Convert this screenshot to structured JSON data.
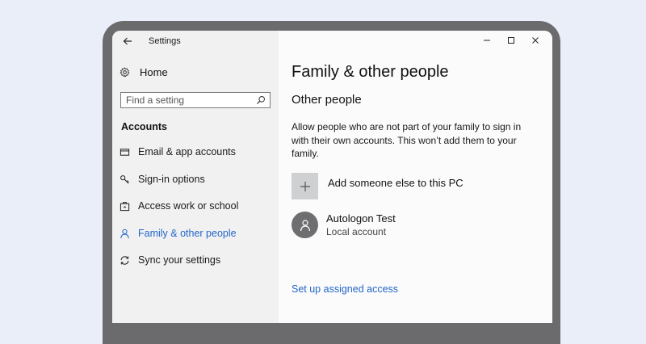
{
  "window": {
    "title": "Settings",
    "controls": [
      "minimize-icon",
      "maximize-icon",
      "close-icon"
    ]
  },
  "sidebar": {
    "home_label": "Home",
    "search_placeholder": "Find a setting",
    "section_label": "Accounts",
    "items": [
      {
        "label": "Email & app accounts",
        "icon": "card-icon",
        "active": false
      },
      {
        "label": "Sign-in options",
        "icon": "key-icon",
        "active": false
      },
      {
        "label": "Access work or school",
        "icon": "briefcase-icon",
        "active": false
      },
      {
        "label": "Family & other people",
        "icon": "person-icon",
        "active": true
      },
      {
        "label": "Sync your settings",
        "icon": "sync-icon",
        "active": false
      }
    ]
  },
  "main": {
    "title": "Family & other people",
    "subtitle": "Other people",
    "description": "Allow people who are not part of your family to sign in with their own accounts. This won’t add them to your family.",
    "add_label": "Add someone else to this PC",
    "user": {
      "name": "Autologon Test",
      "type": "Local account"
    },
    "assigned_access_link": "Set up assigned access"
  },
  "colors": {
    "accent": "#2366c9",
    "frame": "#6b6b6d",
    "background": "#e9eef8"
  }
}
